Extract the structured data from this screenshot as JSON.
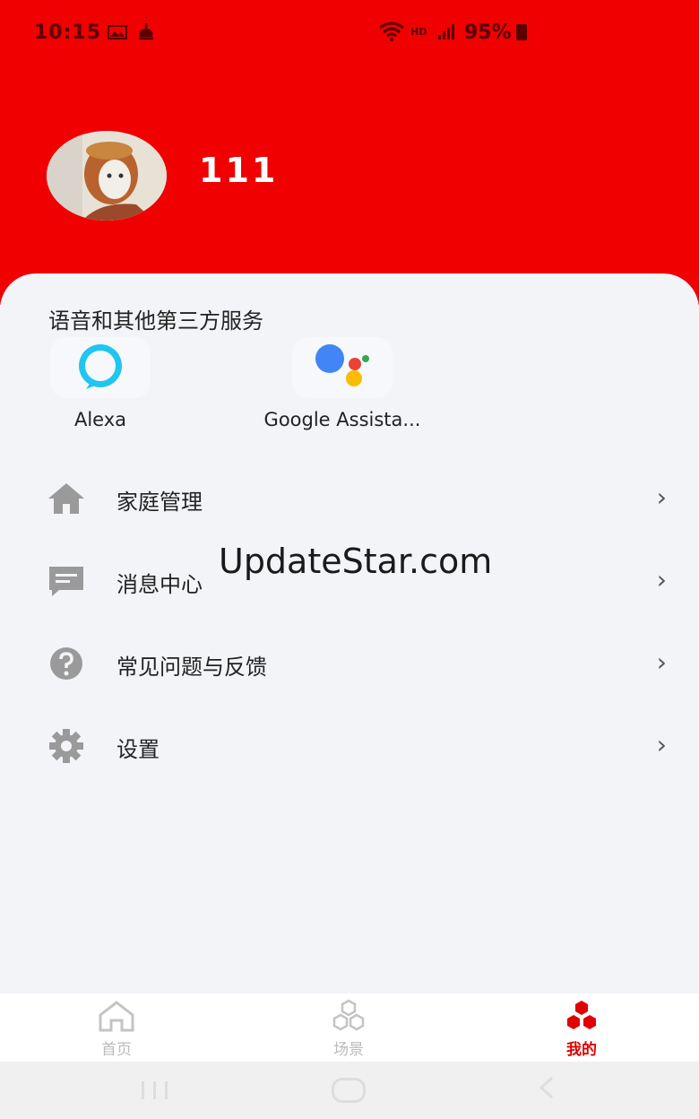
{
  "status_bar": {
    "time": "10:15",
    "hd_label": "HD",
    "battery": "95%"
  },
  "profile": {
    "username": "111"
  },
  "services": {
    "title": "语音和其他第三方服务",
    "items": [
      {
        "label": "Alexa",
        "icon": "alexa-icon"
      },
      {
        "label": "Google Assista...",
        "icon": "google-assistant-icon"
      }
    ]
  },
  "menu": {
    "items": [
      {
        "label": "家庭管理",
        "icon": "home-icon"
      },
      {
        "label": "消息中心",
        "icon": "message-icon"
      },
      {
        "label": "常见问题与反馈",
        "icon": "help-icon"
      },
      {
        "label": "设置",
        "icon": "gear-icon"
      }
    ],
    "chevron": "›"
  },
  "watermark": "UpdateStar.com",
  "tabbar": {
    "tabs": [
      {
        "label": "首页",
        "icon": "home-outline-icon",
        "active": false
      },
      {
        "label": "场景",
        "icon": "scene-icon",
        "active": false
      },
      {
        "label": "我的",
        "icon": "profile-hex-icon",
        "active": true
      }
    ]
  },
  "colors": {
    "brand_red": "#f00000",
    "active_tab": "#e00000",
    "inactive_tab": "#bbbbbb",
    "background": "#f3f4f8"
  }
}
